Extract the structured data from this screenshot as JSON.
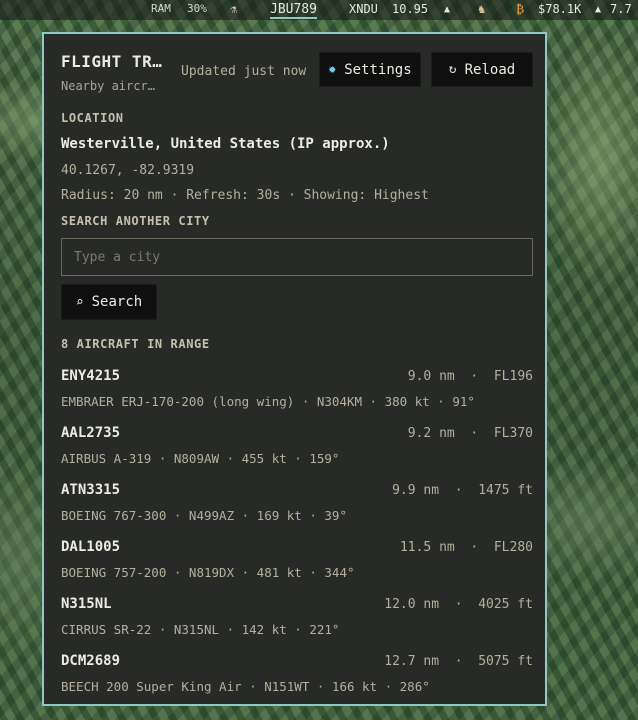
{
  "topbar": {
    "ram_label": "RAM",
    "ram_value": "30%",
    "active_tab": "JBU789",
    "ticker_name": "XNDU",
    "ticker_value": "10.95",
    "ticker_dir": "▲",
    "btc_value": "$78.1K",
    "btc_dir": "▲",
    "btc_change": "7.7"
  },
  "panel": {
    "title": "FLIGHT TR…",
    "subtitle": "Nearby aircr…",
    "updated": "Updated just now",
    "settings_label": "Settings",
    "reload_label": "Reload"
  },
  "location": {
    "label": "LOCATION",
    "city": "Westerville, United States (IP approx.)",
    "coords": "40.1267, -82.9319",
    "meta": "Radius: 20 nm · Refresh: 30s · Showing: Highest"
  },
  "search": {
    "label": "SEARCH ANOTHER CITY",
    "placeholder": "Type a city",
    "value": "",
    "button_label": "Search"
  },
  "aircraft_heading": "8 AIRCRAFT IN RANGE",
  "aircraft": [
    {
      "callsign": "ENY4215",
      "distance": "9.0 nm  ·  FL196",
      "details": "EMBRAER ERJ-170-200 (long wing) · N304KM · 380 kt · 91°"
    },
    {
      "callsign": "AAL2735",
      "distance": "9.2 nm  ·  FL370",
      "details": "AIRBUS A-319 · N809AW · 455 kt · 159°"
    },
    {
      "callsign": "ATN3315",
      "distance": "9.9 nm  ·  1475 ft",
      "details": "BOEING 767-300 · N499AZ · 169 kt · 39°"
    },
    {
      "callsign": "DAL1005",
      "distance": "11.5 nm  ·  FL280",
      "details": "BOEING 757-200 · N819DX · 481 kt · 344°"
    },
    {
      "callsign": "N315NL",
      "distance": "12.0 nm  ·  4025 ft",
      "details": "CIRRUS SR-22 · N315NL · 142 kt · 221°"
    },
    {
      "callsign": "DCM2689",
      "distance": "12.7 nm  ·  5075 ft",
      "details": "BEECH 200 Super King Air · N151WT · 166 kt · 286°"
    }
  ],
  "colors": {
    "accent_border": "#8fc9c4",
    "panel_bg": "#282a28",
    "button_bg": "#0e0f0e"
  }
}
